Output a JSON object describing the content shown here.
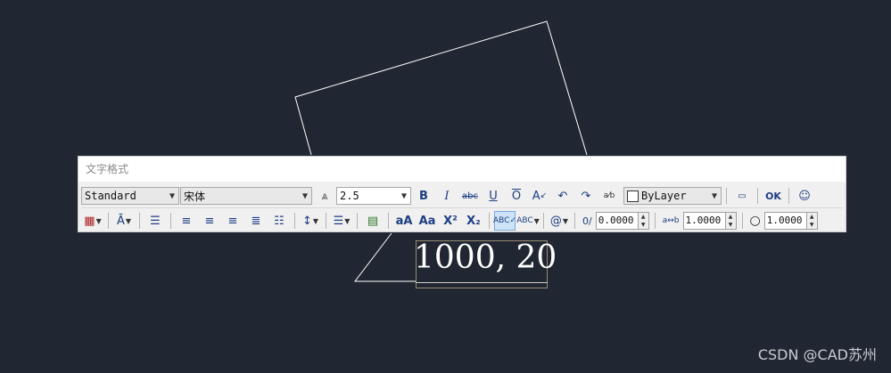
{
  "canvas": {
    "drawn_text": "1000, 20",
    "watermark": "CSDN @CAD苏州"
  },
  "toolbar": {
    "title": "文字格式",
    "style_combo": "Standard",
    "font_combo": "宋体",
    "height_combo": "2.5",
    "color_combo": "ByLayer",
    "ok_label": "OK",
    "oblique_value": "0.0000",
    "tracking_value": "1.0000",
    "width_value": "1.0000"
  },
  "colors": {
    "background": "#212732",
    "icon_blue": "#1f3e82",
    "lines": "#ffffff"
  },
  "icons": {
    "row1": [
      "text-height-icon",
      "bold-icon",
      "italic-icon",
      "strikethrough-icon",
      "underline-icon",
      "overline-icon",
      "font-color-icon",
      "undo-icon",
      "redo-icon",
      "stack-icon",
      "ruler-icon",
      "options-icon"
    ],
    "row2": [
      "column-icon",
      "mtext-justify-icon",
      "paragraph-icon",
      "align-left-icon",
      "align-center-icon",
      "align-right-icon",
      "justify-icon",
      "distribute-icon",
      "line-spacing-icon",
      "numbering-icon",
      "insert-field-icon",
      "uppercase-icon",
      "lowercase-icon",
      "superscript-icon",
      "subscript-icon",
      "spell-check-icon",
      "spell-settings-icon",
      "symbol-icon",
      "oblique-icon",
      "tracking-icon",
      "width-factor-icon"
    ]
  }
}
